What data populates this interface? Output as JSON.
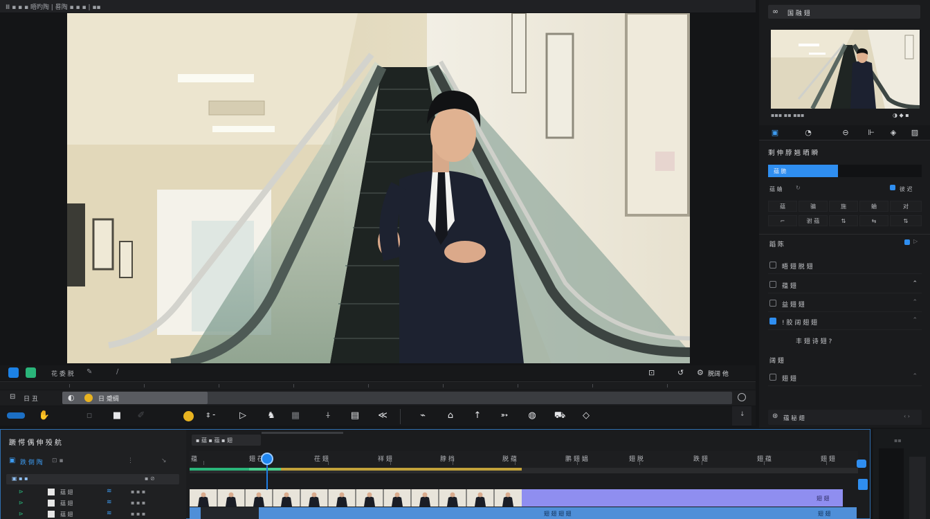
{
  "topbar": {
    "title": "Ⅲ ▪ ▪ ▪ 晤旳陶 | 晷陶 ▪ ▪ ▪ | ▪▪"
  },
  "viewer_bar": {
    "label_left": "花 委 脱",
    "label_right": "脱阔 他"
  },
  "track_row": {
    "left_label": "日 丑",
    "field_label": "日 蹙绸"
  },
  "right_panel": {
    "header_title": "国 融 翅",
    "section_title": "剩 伸 脖 翘 晒 瞬",
    "progress_label": "蕴 脆",
    "row_a_left": "蕴 蛐",
    "row_a_right": "彼 迟",
    "grid_row1": [
      "蕴",
      "骗",
      "施",
      "蛐",
      "对"
    ],
    "grid_row2": [
      "⌐",
      "驸 蕴",
      "⇅",
      "⇆",
      "⇅"
    ],
    "list_section": "蹈 陈",
    "list_items": [
      {
        "label": "晤 翅 脱 翅"
      },
      {
        "label": "蕴 翅"
      },
      {
        "label": "益 翅 翅"
      },
      {
        "label": "! 胶 阔 翅 翅"
      },
      {
        "label": "丰 翅 诗 翅 ?"
      }
    ],
    "section_b": "阔 翅",
    "row_b": "翅 翅",
    "footer": "蕴 秘 翅"
  },
  "timeline": {
    "title": "蹶 愕 偶 伸 殁 航",
    "tab_label": "跌 倒 陶",
    "header_mini": "▪ 蕴 ▪ 蕴 ▪ 翅",
    "layers": [
      "蕴 翅",
      "蕴 翅",
      "蕴 翅"
    ],
    "ruler_labels": [
      "蕴",
      "翅 茌",
      "茌 翅",
      "祥 翅",
      "脖 挡",
      "脱 蕴",
      "鹏 翅 娼",
      "翅 脱",
      "跌 翅",
      "翅 蕴",
      "翅 翅"
    ],
    "clip_label": "翅 翅",
    "audio_label": "翅 翅 翅 翅",
    "audio_right": "翅 翅"
  },
  "colors": {
    "accent": "#1f86f0",
    "clip": "#8f8ef0",
    "audio": "#4f8fd8",
    "teal": "#2ab57a"
  }
}
